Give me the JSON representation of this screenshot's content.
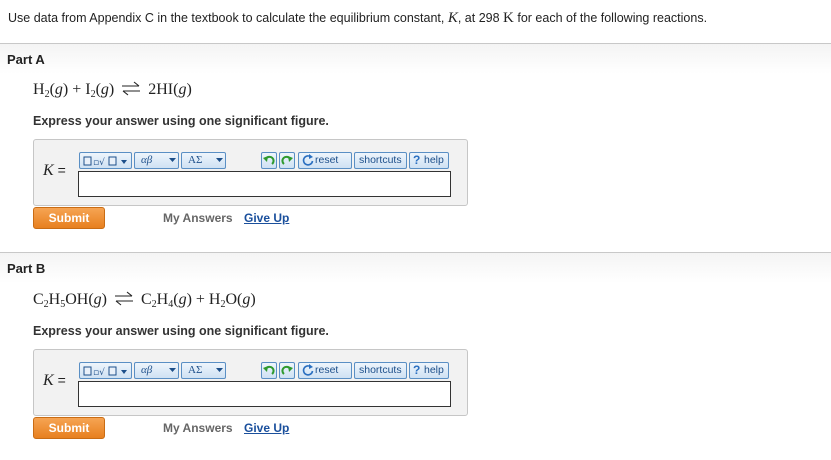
{
  "intro": {
    "text_before": "Use data from Appendix C in the textbook to calculate the equilibrium constant, ",
    "K": "K",
    "text_mid": ", at 298 ",
    "kelvin": "K",
    "text_after": " for each of the following reactions."
  },
  "parts": [
    {
      "title": "Part A",
      "reaction": {
        "lhs": [
          [
            "H",
            "2",
            "(",
            "g",
            ")"
          ],
          [
            "I",
            "2",
            "(",
            "g",
            ")"
          ]
        ],
        "rhs_text": "2HI(",
        "rhs_g": "g",
        "rhs_close": ")",
        "plus": "+"
      },
      "instruction": "Express your answer using one significant figure.",
      "answer_label": "K",
      "equals": "=",
      "answer_value": "",
      "submit": "Submit",
      "my_answers": "My Answers",
      "give_up": "Give Up"
    },
    {
      "title": "Part B",
      "instruction": "Express your answer using one significant figure.",
      "answer_label": "K",
      "equals": "=",
      "answer_value": "",
      "submit": "Submit",
      "my_answers": "My Answers",
      "give_up": "Give Up"
    }
  ],
  "reactionA": {
    "h": "H",
    "h_sub": "2",
    "open": "(",
    "g": "g",
    "close": ")",
    "plus": "+",
    "i": "I",
    "i_sub": "2",
    "product": "2HI"
  },
  "reactionB": {
    "c": "C",
    "c_sub": "2",
    "h": "H",
    "h_sub": "5",
    "oh": "OH",
    "open": "(",
    "g": "g",
    "close": ")",
    "c2": "C",
    "c2_sub": "2",
    "h2": "H",
    "h2_sub": "4",
    "plus": "+",
    "h3": "H",
    "h3_sub": "2",
    "o": "O"
  },
  "toolbar": {
    "template_label": "▢√▢",
    "greek_label": "αβ",
    "symbol_label": "ΑΣ",
    "reset": "reset",
    "shortcuts": "shortcuts",
    "help": "help",
    "help_icon": "?",
    "icons": [
      "templates-icon",
      "greek-letters-icon",
      "symbols-icon",
      "undo-icon",
      "redo-icon",
      "reset-icon",
      "help-icon"
    ]
  },
  "colors": {
    "submit_orange": "#e7801f",
    "toolbar_blue": "#1d4f8a",
    "link_blue": "#1a4f9c"
  }
}
